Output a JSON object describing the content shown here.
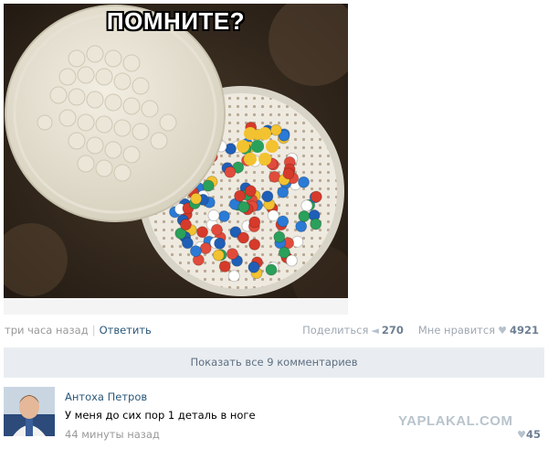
{
  "post": {
    "photo_caption": "ПОМНИТЕ?",
    "time": "три часа назад",
    "reply_label": "Ответить",
    "share_label": "Поделиться",
    "share_count": "270",
    "like_label": "Мне нравится",
    "like_count": "4921"
  },
  "comments": {
    "show_all_label": "Показать все 9 комментариев",
    "items": [
      {
        "author": "Антоха Петров",
        "text": "У меня до сих пор 1 деталь в ноге",
        "time": "44 минуты назад",
        "likes": "45"
      }
    ]
  },
  "watermark": "YAPLAKAL.COM",
  "icons": {
    "share": "megaphone-icon",
    "like": "heart-icon"
  },
  "colors": {
    "link": "#2b587a",
    "muted": "#999999",
    "bar_bg": "#e9edf1"
  }
}
